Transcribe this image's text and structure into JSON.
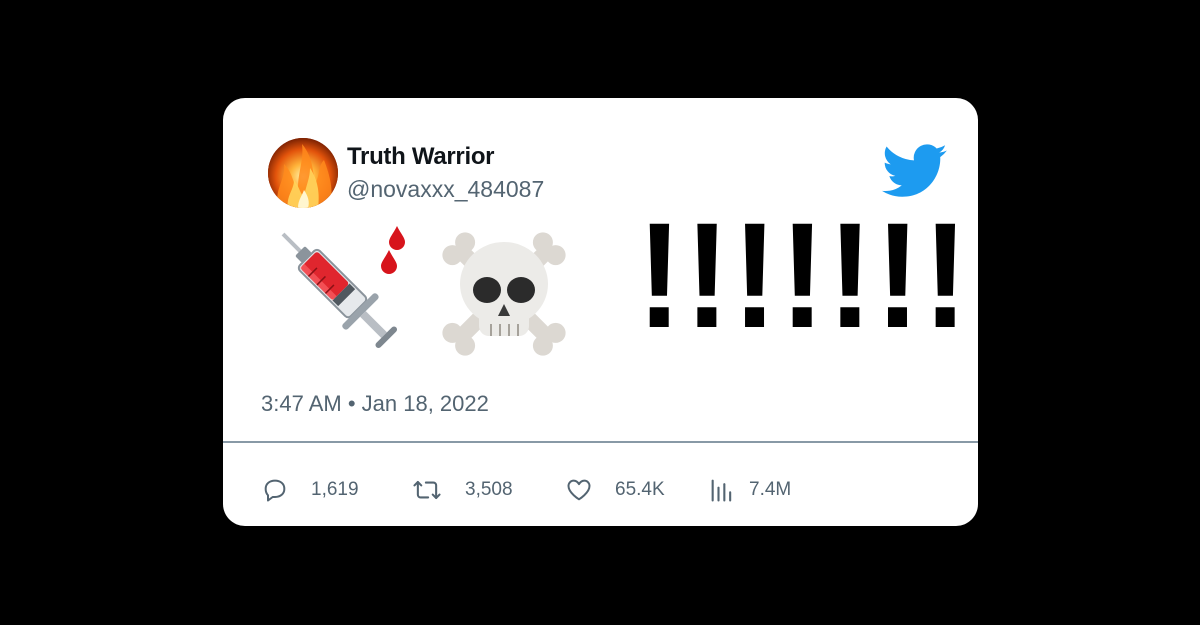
{
  "tweet": {
    "author": {
      "display_name": "Truth Warrior",
      "handle": "@novaxxx_484087",
      "avatar": "fire-avatar"
    },
    "body": {
      "emojis": [
        "syringe-emoji",
        "blood-drop-emoji",
        "skull-and-crossbones-emoji"
      ],
      "text": "!!!!!!!!!!"
    },
    "timestamp": "3:47 AM • Jan 18, 2022",
    "stats": {
      "replies": "1,619",
      "retweets": "3,508",
      "likes": "65.4K",
      "views": "7.4M"
    }
  },
  "colors": {
    "background": "#000000",
    "card": "#ffffff",
    "twitter_blue": "#1d9bf0",
    "muted_text": "#536471",
    "divider": "#8899a6"
  },
  "icons": {
    "brand": "twitter-bird-icon",
    "reply": "reply-icon",
    "retweet": "retweet-icon",
    "like": "heart-icon",
    "views": "views-icon"
  }
}
